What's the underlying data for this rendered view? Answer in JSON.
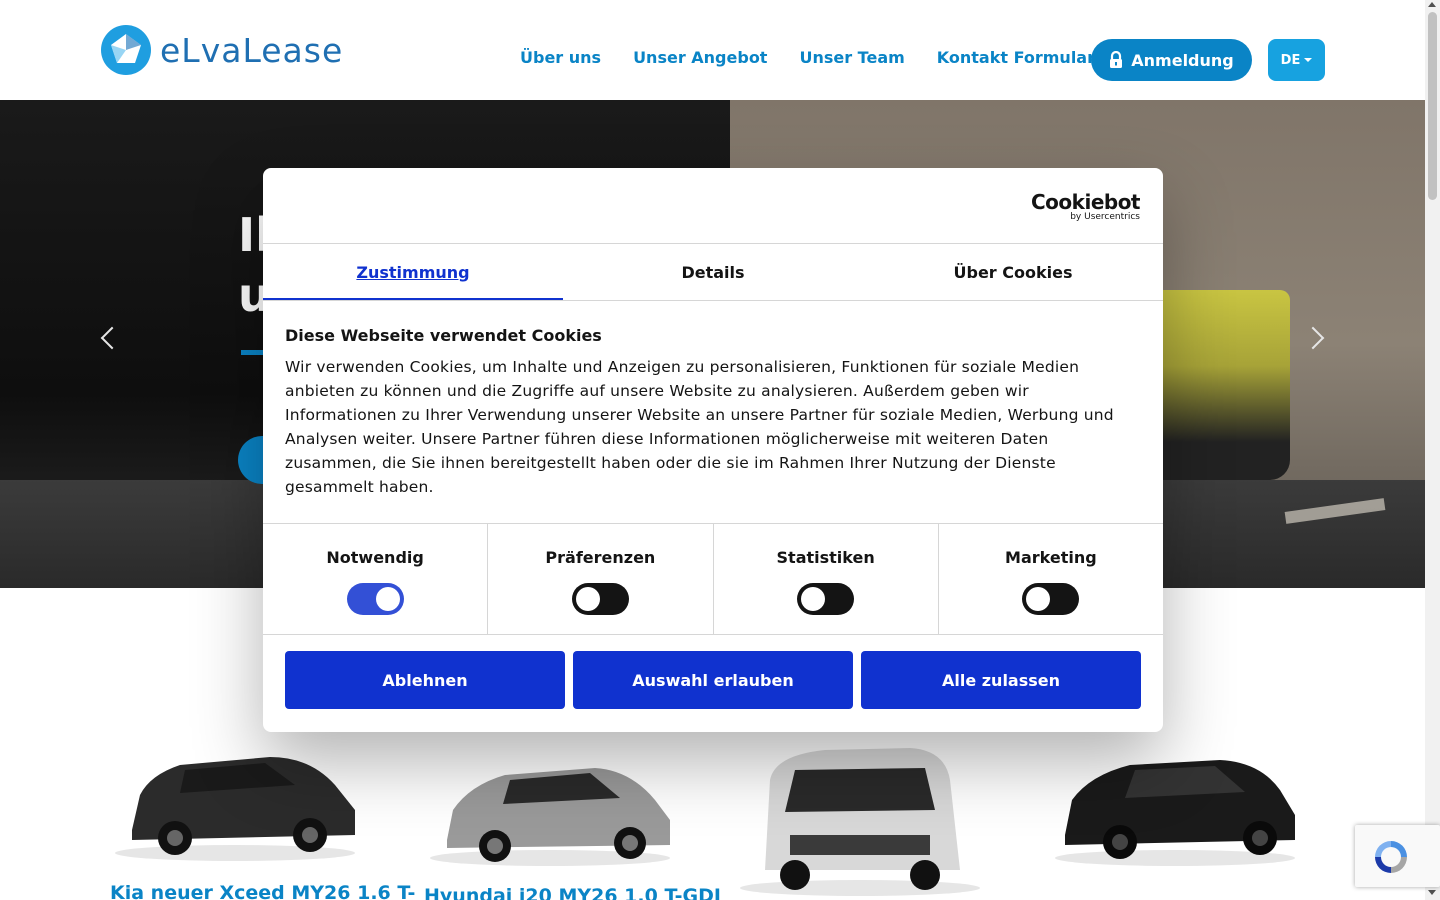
{
  "header": {
    "logo_text": "eLvaLease",
    "nav": [
      "Über uns",
      "Unser Angebot",
      "Unser Team",
      "Kontakt Formular"
    ],
    "login_label": "Anmeldung",
    "language": "DE"
  },
  "hero": {
    "title_line1": "Ih",
    "title_line2": "u"
  },
  "cars": [
    {
      "title": "Kia neuer Xceed MY26 1.6 T-"
    },
    {
      "title": "Hyundai i20 MY26 1.0 T-GDI"
    }
  ],
  "cookie": {
    "brand": "Cookiebot",
    "brand_sub": "by Usercentrics",
    "tabs": [
      "Zustimmung",
      "Details",
      "Über Cookies"
    ],
    "heading": "Diese Webseite verwendet Cookies",
    "text": "Wir verwenden Cookies, um Inhalte und Anzeigen zu personalisieren, Funktionen für soziale Medien anbieten zu können und die Zugriffe auf unsere Website zu analysieren. Außerdem geben wir Informationen zu Ihrer Verwendung unserer Website an unsere Partner für soziale Medien, Werbung und Analysen weiter. Unsere Partner führen diese Informationen möglicherweise mit weiteren Daten zusammen, die Sie ihnen bereitgestellt haben oder die sie im Rahmen Ihrer Nutzung der Dienste gesammelt haben.",
    "toggles": [
      {
        "label": "Notwendig",
        "on": true
      },
      {
        "label": "Präferenzen",
        "on": false
      },
      {
        "label": "Statistiken",
        "on": false
      },
      {
        "label": "Marketing",
        "on": false
      }
    ],
    "buttons": [
      "Ablehnen",
      "Auswahl erlauben",
      "Alle zulassen"
    ]
  },
  "colors": {
    "brand_blue": "#0a84c6",
    "cookie_blue": "#1032cf"
  }
}
